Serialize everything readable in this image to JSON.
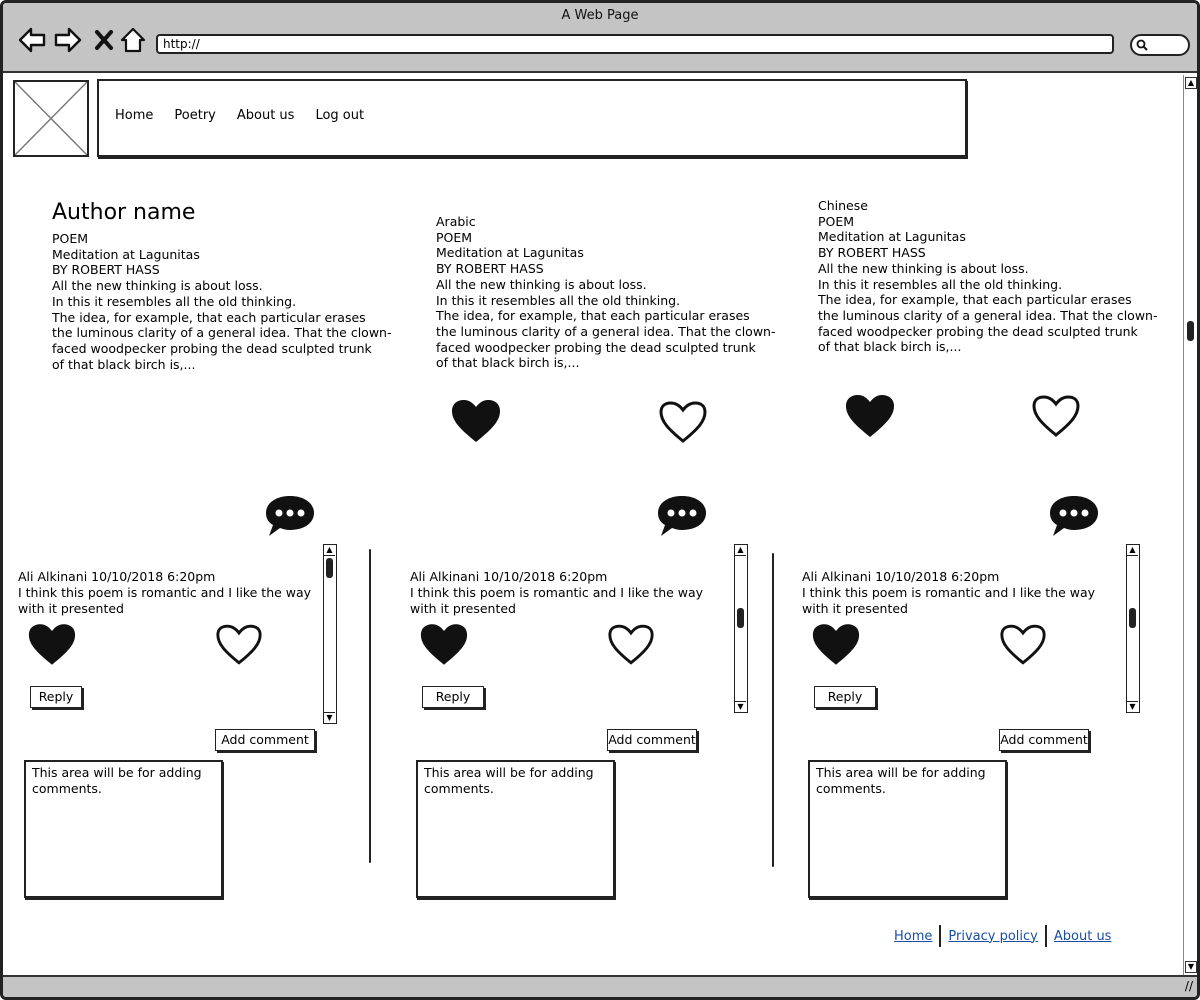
{
  "window": {
    "title": "A Web Page",
    "url": "http://"
  },
  "nav": {
    "items": [
      "Home",
      "Poetry",
      "About us",
      "Log out"
    ]
  },
  "columns": [
    {
      "title": "Author name",
      "lines": [
        "POEM",
        "Meditation at Lagunitas",
        "BY ROBERT HASS",
        "All the new thinking is about loss.",
        "In this it resembles all the old thinking.",
        "The idea, for example, that each particular erases",
        "the luminous clarity of a general idea. That the clown-",
        "faced woodpecker probing the dead sculpted trunk",
        "of that black birch is,..."
      ]
    },
    {
      "title": "",
      "lines": [
        "Arabic",
        "POEM",
        "Meditation at Lagunitas",
        "BY ROBERT HASS",
        "All the new thinking is about loss.",
        "In this it resembles all the old thinking.",
        "The idea, for example, that each particular erases",
        "the luminous clarity of a general idea. That the clown-",
        "faced woodpecker probing the dead sculpted trunk",
        "of that black birch is,..."
      ]
    },
    {
      "title": "",
      "lines": [
        "Chinese",
        "POEM",
        "Meditation at Lagunitas",
        "BY ROBERT HASS",
        "All the new thinking is about loss.",
        "In this it resembles all the old thinking.",
        "The idea, for example, that each particular erases",
        "the luminous clarity of a general idea. That the clown-",
        "faced woodpecker probing the dead sculpted trunk",
        "of that black birch is,..."
      ]
    }
  ],
  "comment": {
    "author_date": "Ali Alkinani 10/10/2018 6:20pm",
    "text_line1": "I think this poem is romantic and I like the way",
    "text_line2": "with it presented",
    "reply_label": "Reply",
    "add_comment_label": "Add comment",
    "textarea_line1": "This area will be for adding",
    "textarea_line2": "comments."
  },
  "footer": {
    "links": [
      "Home",
      "Privacy policy",
      "About us"
    ]
  },
  "icons": {
    "back": "back-arrow-icon",
    "forward": "forward-arrow-icon",
    "stop": "close-icon",
    "home": "home-icon",
    "search": "search-icon",
    "like": "filled-heart-icon",
    "unlike": "outline-heart-icon",
    "comment": "comment-bubble-icon"
  }
}
